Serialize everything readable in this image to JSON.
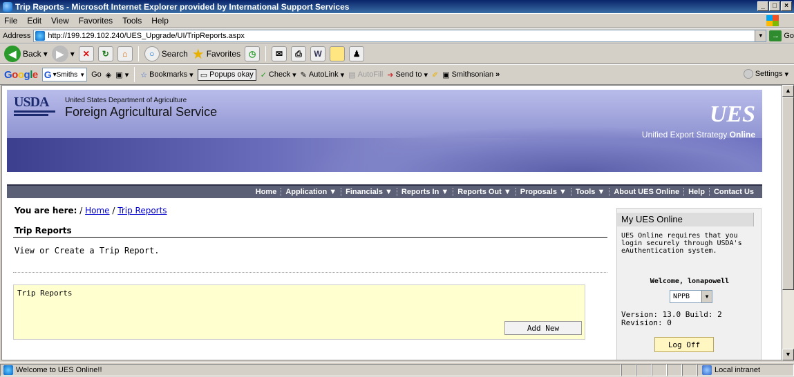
{
  "window": {
    "title": "Trip Reports - Microsoft Internet Explorer provided by International Support Services"
  },
  "menu": [
    "File",
    "Edit",
    "View",
    "Favorites",
    "Tools",
    "Help"
  ],
  "address": {
    "label": "Address",
    "url": "http://199.129.102.240/UES_Upgrade/UI/TripReports.aspx",
    "go": "Go"
  },
  "toolbar": {
    "back": "Back",
    "search": "Search",
    "favorites": "Favorites"
  },
  "googlebar": {
    "logo": "Google",
    "search_select": "Smiths",
    "go": "Go",
    "bookmarks": "Bookmarks",
    "popups": "Popups okay",
    "check": "Check",
    "autolink": "AutoLink",
    "autofill": "AutoFill",
    "sendto": "Send to",
    "smithsonian": "Smithsonian",
    "more": "»",
    "settings": "Settings"
  },
  "banner": {
    "usda": "USDA",
    "dept": "United States Department of Agriculture",
    "agency": "Foreign Agricultural Service",
    "ues_logo": "UES",
    "tagline": "Unified Export Strategy",
    "tagline_bold": "Online"
  },
  "nav": [
    "Home",
    "Application ▼",
    "Financials ▼",
    "Reports In ▼",
    "Reports Out ▼",
    "Proposals ▼",
    "Tools ▼",
    "About UES Online",
    "Help",
    "Contact Us"
  ],
  "breadcrumb": {
    "prefix": "You are here:",
    "sep": "/",
    "home": "Home",
    "current": "Trip Reports"
  },
  "page": {
    "title": "Trip Reports",
    "description": "View or Create a Trip Report.",
    "box_label": "Trip Reports",
    "add_new": "Add New"
  },
  "sidebar": {
    "title": "My UES Online",
    "info": "UES Online requires that you login securely through USDA's eAuthentication system.",
    "welcome": "Welcome, lonapowell",
    "org_selected": "NPPB",
    "version": "Version: 13.0 Build: 2 Revision: 0",
    "logoff": "Log Off"
  },
  "status": {
    "message": "Welcome to UES Online!!",
    "zone": "Local intranet"
  }
}
